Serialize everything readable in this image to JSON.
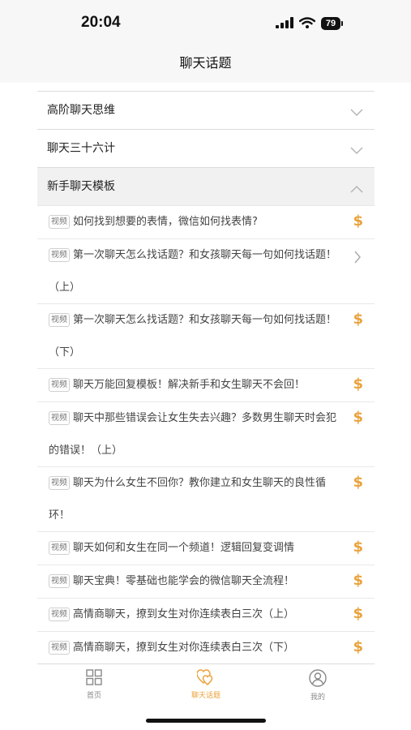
{
  "status": {
    "time": "20:04",
    "battery": "79"
  },
  "navbar": {
    "title": "聊天话题"
  },
  "sections": [
    {
      "title": "高阶聊天思维"
    },
    {
      "title": "聊天三十六计"
    },
    {
      "title": "新手聊天模板"
    }
  ],
  "items": [
    {
      "tag": "视频",
      "text": "如何找到想要的表情，微信如何找表情?",
      "indicator": "$"
    },
    {
      "tag": "视频",
      "text": "第一次聊天怎么找话题？和女孩聊天每一句如何找话题！（上）",
      "indicator": "chevron-right"
    },
    {
      "tag": "视频",
      "text": "第一次聊天怎么找话题？和女孩聊天每一句如何找话题！（下）",
      "indicator": "$"
    },
    {
      "tag": "视频",
      "text": "聊天万能回复模板！解决新手和女生聊天不会回！",
      "indicator": "$"
    },
    {
      "tag": "视频",
      "text": "聊天中那些错误会让女生失去兴趣？多数男生聊天时会犯的错误！（上）",
      "indicator": "$"
    },
    {
      "tag": "视频",
      "text": "聊天为什么女生不回你？教你建立和女生聊天的良性循环！",
      "indicator": "$"
    },
    {
      "tag": "视频",
      "text": "聊天如何和女生在同一个频道！逻辑回复变调情",
      "indicator": "$"
    },
    {
      "tag": "视频",
      "text": "聊天宝典！零基础也能学会的微信聊天全流程！",
      "indicator": "$"
    },
    {
      "tag": "视频",
      "text": "高情商聊天，撩到女生对你连续表白三次（上）",
      "indicator": "$"
    },
    {
      "tag": "视频",
      "text": "高情商聊天，撩到女生对你连续表白三次（下）",
      "indicator": "$"
    }
  ],
  "tabs": [
    {
      "label": "首页",
      "icon": "grid-icon"
    },
    {
      "label": "聊天话题",
      "icon": "hearts-icon"
    },
    {
      "label": "我的",
      "icon": "user-icon"
    }
  ],
  "colors": {
    "accent": "#e9a23b",
    "chrome": "#f7f7f7",
    "expanded": "#f1f1f1"
  }
}
